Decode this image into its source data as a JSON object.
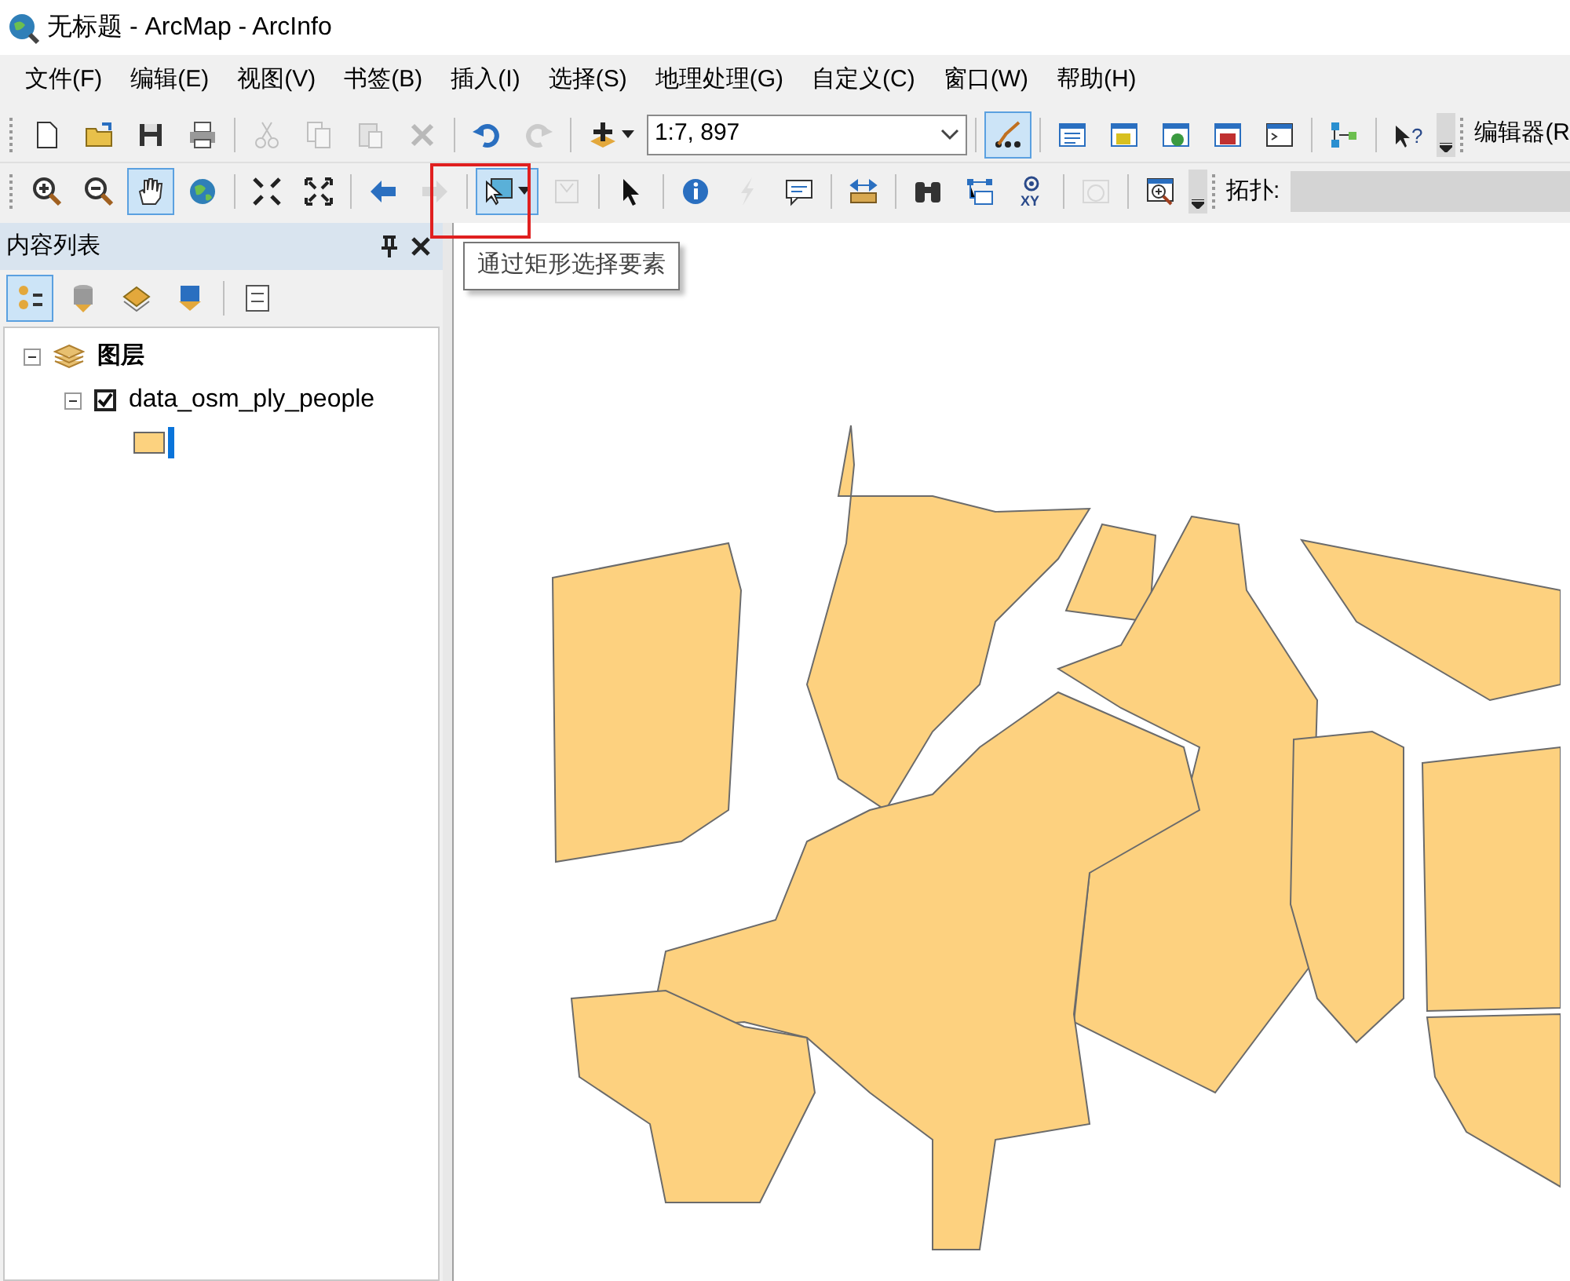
{
  "window": {
    "title": "无标题 - ArcMap - ArcInfo"
  },
  "menu": [
    "文件(F)",
    "编辑(E)",
    "视图(V)",
    "书签(B)",
    "插入(I)",
    "选择(S)",
    "地理处理(G)",
    "自定义(C)",
    "窗口(W)",
    "帮助(H)"
  ],
  "standard_toolbar": {
    "tools": [
      {
        "selected": false,
        "disabled": false
      },
      {
        "selected": false,
        "disabled": false
      },
      {
        "selected": false,
        "disabled": false
      },
      {
        "selected": false,
        "disabled": false
      },
      {
        "selected": false,
        "disabled": true
      },
      {
        "selected": false,
        "disabled": true
      },
      {
        "selected": false,
        "disabled": true
      },
      {
        "selected": false,
        "disabled": true
      },
      {
        "selected": false,
        "disabled": false
      },
      {
        "selected": false,
        "disabled": true
      },
      {
        "selected": false,
        "disabled": false
      },
      {
        "selected": true,
        "disabled": false
      },
      {
        "selected": false,
        "disabled": false
      },
      {
        "selected": false,
        "disabled": false
      },
      {
        "selected": false,
        "disabled": false
      },
      {
        "selected": false,
        "disabled": false
      },
      {
        "selected": false,
        "disabled": false
      },
      {
        "selected": false,
        "disabled": false
      },
      {
        "selected": false,
        "disabled": false
      }
    ],
    "scale": "1:7, 897",
    "help_glyph": "?",
    "editor_label": "编辑器(R"
  },
  "tools_toolbar": {
    "tools": [
      {
        "selected": false,
        "disabled": false
      },
      {
        "selected": false,
        "disabled": false
      },
      {
        "selected": true,
        "disabled": false
      },
      {
        "selected": false,
        "disabled": false
      },
      {
        "selected": false,
        "disabled": false
      },
      {
        "selected": false,
        "disabled": false
      },
      {
        "selected": false,
        "disabled": false
      },
      {
        "selected": false,
        "disabled": true
      },
      {
        "selected": true,
        "disabled": false
      },
      {
        "selected": false,
        "disabled": true
      },
      {
        "selected": false,
        "disabled": false
      },
      {
        "selected": false,
        "disabled": false
      },
      {
        "selected": false,
        "disabled": true
      },
      {
        "selected": false,
        "disabled": false
      },
      {
        "selected": false,
        "disabled": false
      },
      {
        "selected": false,
        "disabled": false
      },
      {
        "selected": false,
        "disabled": false
      },
      {
        "selected": false,
        "disabled": false
      },
      {
        "selected": false,
        "disabled": true
      },
      {
        "selected": false,
        "disabled": false
      }
    ],
    "xy_glyph": "XY",
    "topology_label": "拓扑:"
  },
  "tooltip": "通过矩形选择要素",
  "toc": {
    "title": "内容列表",
    "tabs": [
      {
        "selected": true
      },
      {
        "selected": false
      },
      {
        "selected": false
      },
      {
        "selected": false
      },
      {
        "selected": false
      }
    ],
    "tree": [
      {
        "label": "图层",
        "expanded": true,
        "children": [
          {
            "label": "data_osm_ply_people",
            "checked": true,
            "expanded": true
          }
        ]
      }
    ]
  }
}
